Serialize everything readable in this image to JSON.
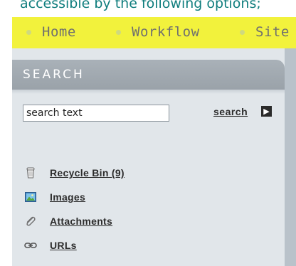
{
  "intro_text": "accessible by the following options;",
  "nav": {
    "items": [
      {
        "label": "Home"
      },
      {
        "label": "Workflow"
      },
      {
        "label": "Site"
      }
    ]
  },
  "search_panel": {
    "title": "SEARCH",
    "input_value": "search text",
    "search_label": "search",
    "search_arrow": "▶",
    "links": [
      {
        "label": "Recycle Bin (9)",
        "icon": "recycle-bin-icon"
      },
      {
        "label": "Images",
        "icon": "image-icon"
      },
      {
        "label": "Attachments",
        "icon": "paperclip-icon"
      },
      {
        "label": "URLs",
        "icon": "link-icon"
      }
    ]
  },
  "colors": {
    "nav_bg": "#f2f23c",
    "panel_bg": "#e1e6ea",
    "panel_header": "#9aa2a9",
    "intro_text": "#0f7d7d"
  }
}
